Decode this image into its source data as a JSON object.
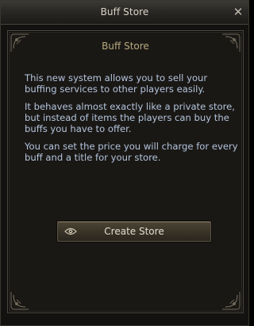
{
  "window": {
    "title": "Buff Store",
    "close_symbol": "✕"
  },
  "panel": {
    "heading": "Buff Store",
    "paragraphs": [
      "This new system allows you to sell your buffing services to other players easily.",
      "It behaves almost exactly like a private store, but instead of items the players can buy the buffs you have to offer.",
      "You can set the price you will charge for every buff and a title for your store."
    ],
    "create_button": {
      "label": "Create Store",
      "icon": "eye-icon"
    }
  },
  "colors": {
    "title_text": "#d9d4c6",
    "heading_text": "#b7a97f",
    "body_text": "#b3c4dc",
    "panel_bg": "#1a1815"
  }
}
